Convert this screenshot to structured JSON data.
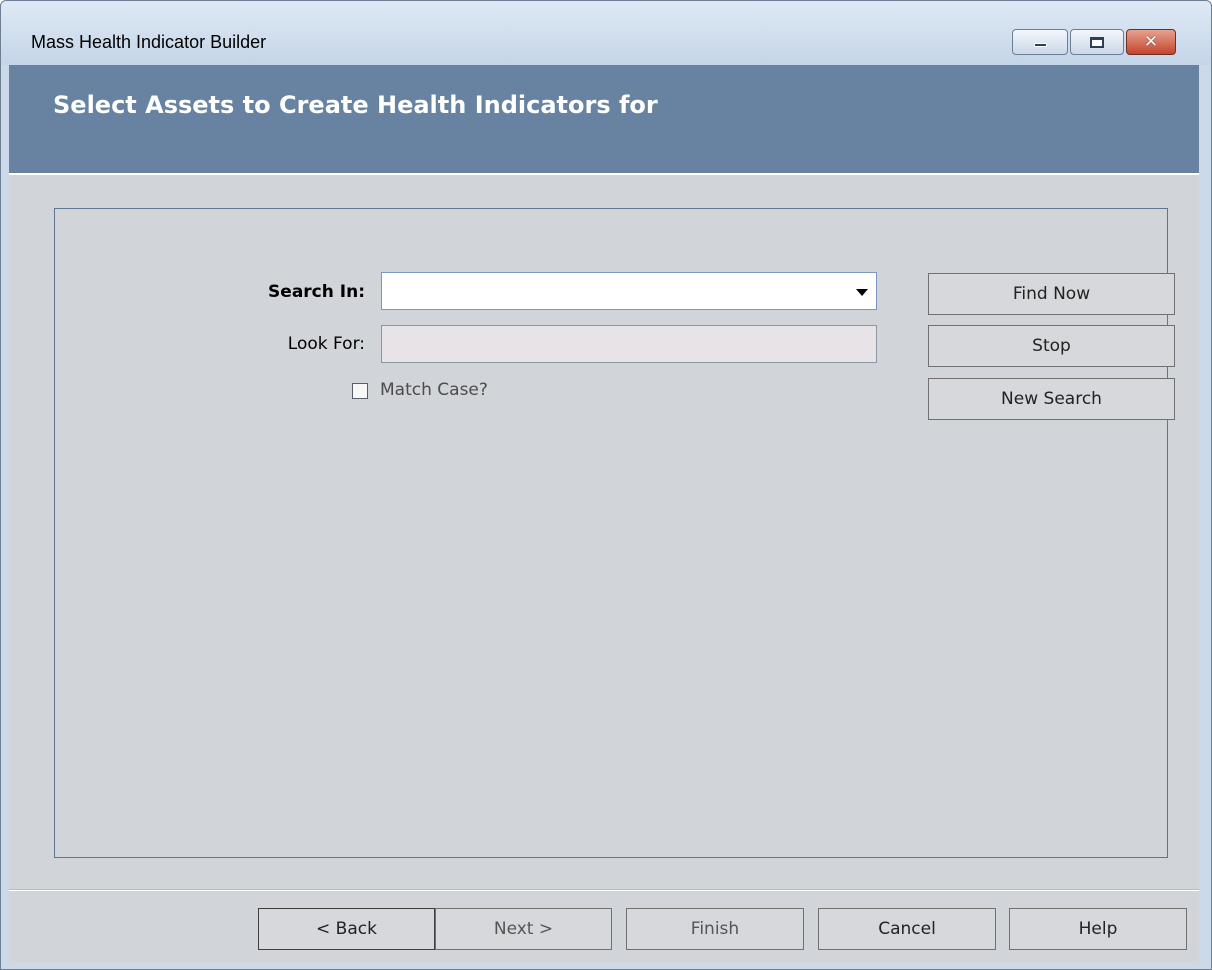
{
  "window": {
    "title": "Mass Health Indicator Builder",
    "controls": {
      "minimize": "minimize-icon",
      "maximize": "maximize-icon",
      "close": "close-icon"
    }
  },
  "header": {
    "heading": "Select Assets to Create Health Indicators for"
  },
  "search": {
    "search_in_label": "Search In:",
    "search_in_value": "",
    "look_for_label": "Look For:",
    "look_for_value": "",
    "match_case_label": "Match Case?",
    "match_case_checked": false
  },
  "side_buttons": {
    "find_now": "Find Now",
    "stop": "Stop",
    "new_search": "New Search"
  },
  "footer": {
    "back": "< Back",
    "next": "Next >",
    "finish": "Finish",
    "cancel": "Cancel",
    "help": "Help"
  },
  "colors": {
    "header_band": "#6883a1",
    "content_bg": "#d1d4d8",
    "close_button": "#c5452d"
  }
}
